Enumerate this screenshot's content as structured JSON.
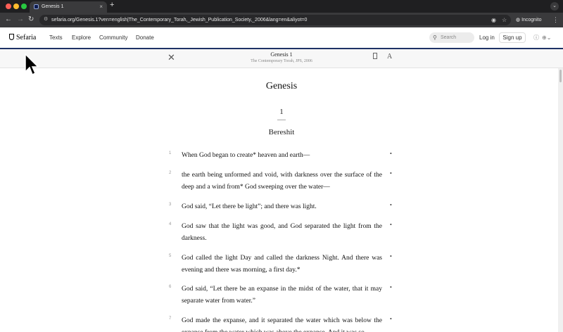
{
  "browser": {
    "tab_title": "Genesis 1",
    "tab_close": "×",
    "new_tab": "+",
    "url": "sefaria.org/Genesis.1?ven=english|The_Contemporary_Torah,_Jewish_Publication_Society,_2006&lang=en&aliyot=0",
    "incognito_label": "Incognito",
    "traffic_colors": [
      "#ff5f57",
      "#febc2e",
      "#28c840"
    ]
  },
  "site": {
    "logo_text": "Sefaria",
    "nav": [
      "Texts",
      "Explore",
      "Community",
      "Donate"
    ],
    "search_placeholder": "Search",
    "login": "Log in",
    "signup": "Sign up",
    "accent_color": "#1e3266"
  },
  "reader": {
    "ref": "Genesis 1",
    "version": "The Contemporary Torah, JPS, 2006",
    "font_button": "A"
  },
  "text": {
    "book": "Genesis",
    "chapter": "1",
    "parasha": "Bereshit",
    "verses": [
      {
        "num": "1",
        "text": "When God began to create* heaven and earth—"
      },
      {
        "num": "2",
        "text": "the earth being unformed and void, with darkness over the surface of the deep and a wind from* God sweeping over the water—"
      },
      {
        "num": "3",
        "text": "God said, “Let there be light”; and there was light."
      },
      {
        "num": "4",
        "text": "God saw that the light was good, and God separated the light from the darkness."
      },
      {
        "num": "5",
        "text": "God called the light Day and called the darkness Night. And there was evening and there was morning, a first day.*"
      },
      {
        "num": "6",
        "text": "God said, “Let there be an expanse in the midst of the water, that it may separate water from water.”"
      },
      {
        "num": "7",
        "text": "God made the expanse, and it separated the water which was below the expanse from the water which was above the expanse. And it was so."
      }
    ],
    "verse_marker": "•"
  }
}
